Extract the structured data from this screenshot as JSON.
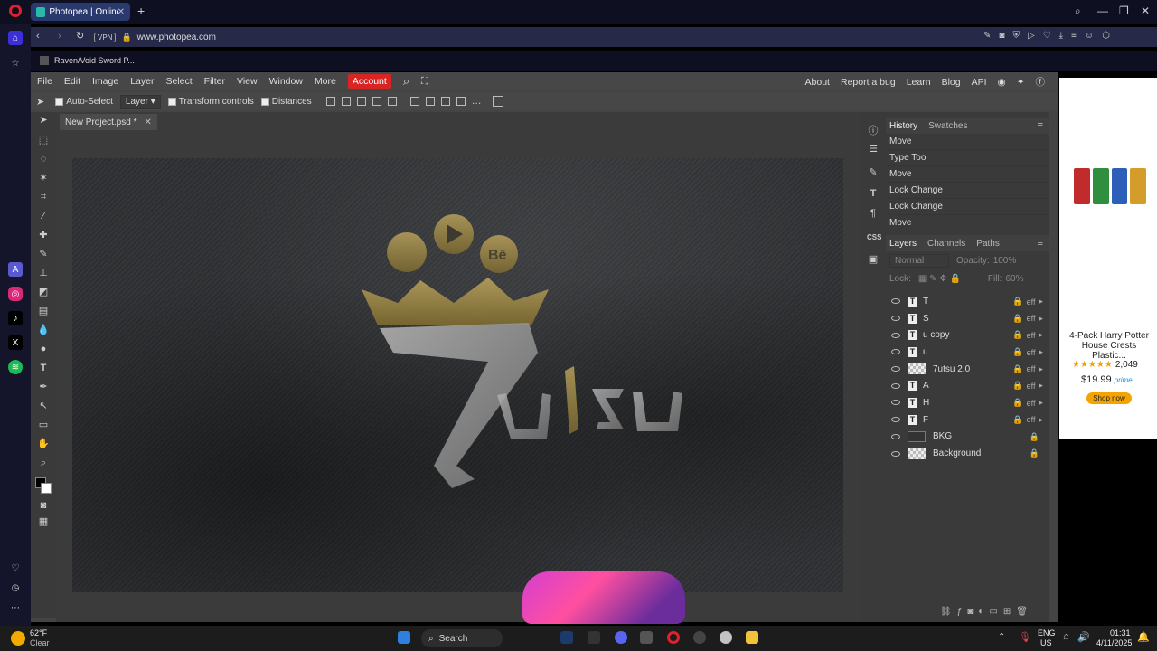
{
  "browser": {
    "tab_title": "Photopea | Online Photo",
    "url": "www.photopea.com",
    "vpn_label": "VPN",
    "bookmark": "Raven/Void Sword P..."
  },
  "menubar": {
    "items": [
      "File",
      "Edit",
      "Image",
      "Layer",
      "Select",
      "Filter",
      "View",
      "Window",
      "More"
    ],
    "account": "Account",
    "right": [
      "About",
      "Report a bug",
      "Learn",
      "Blog",
      "API"
    ]
  },
  "options": {
    "auto_select": "Auto-Select",
    "layer_select": "Layer",
    "transform_controls": "Transform controls",
    "distances": "Distances"
  },
  "document": {
    "tab_name": "New Project.psd *"
  },
  "history": {
    "tabs": [
      "History",
      "Swatches"
    ],
    "items": [
      "Move",
      "Type Tool",
      "Move",
      "Lock Change",
      "Lock Change",
      "Move"
    ]
  },
  "layers_panel": {
    "tabs": [
      "Layers",
      "Channels",
      "Paths"
    ],
    "blend_mode": "Normal",
    "opacity_label": "Opacity:",
    "opacity_value": "100%",
    "lock_label": "Lock:",
    "fill_label": "Fill:",
    "fill_value": "60%",
    "css_label": "CSS",
    "eff_label": "eff",
    "layers": [
      {
        "name": "T",
        "type": "text"
      },
      {
        "name": "S",
        "type": "text"
      },
      {
        "name": "u copy",
        "type": "text"
      },
      {
        "name": "u",
        "type": "text"
      },
      {
        "name": "7utsu 2.0",
        "type": "image"
      },
      {
        "name": "A",
        "type": "text"
      },
      {
        "name": "H",
        "type": "text"
      },
      {
        "name": "F",
        "type": "text"
      },
      {
        "name": "BKG",
        "type": "dark"
      },
      {
        "name": "Background",
        "type": "image"
      }
    ]
  },
  "ad": {
    "title": "4-Pack Harry Potter House Crests Plastic...",
    "rating_count": "2,049",
    "price": "$19.99",
    "prime": "prime",
    "cta": "Shop now"
  },
  "taskbar": {
    "weather_temp": "62°F",
    "weather_desc": "Clear",
    "search": "Search",
    "lang": "ENG",
    "region": "US",
    "time": "01:31",
    "date": "4/11/2025"
  },
  "colors": {
    "accent_red": "#d92424",
    "gold": "#a8914a",
    "stone": "#9a9a9a"
  }
}
